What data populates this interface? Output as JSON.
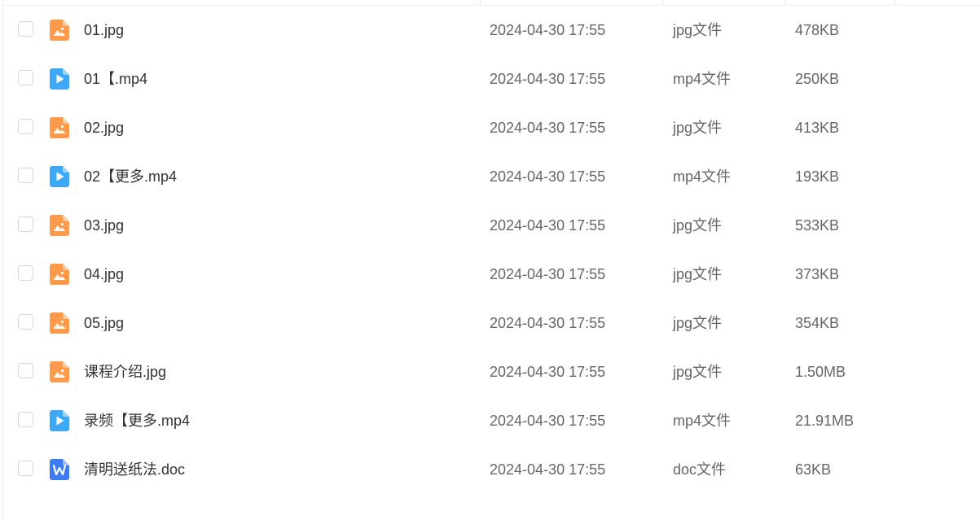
{
  "colors": {
    "image_icon": "#FF9A4D",
    "video_icon": "#3DA8F5",
    "doc_icon": "#3D7BF2",
    "name_text": "#333333",
    "meta_text": "#666666"
  },
  "files": [
    {
      "name": "01.jpg",
      "modified": "2024-04-30 17:55",
      "type": "jpg文件",
      "size": "478KB",
      "icon": "image-file-icon"
    },
    {
      "name": "01【.mp4",
      "modified": "2024-04-30 17:55",
      "type": "mp4文件",
      "size": "250KB",
      "icon": "video-file-icon"
    },
    {
      "name": "02.jpg",
      "modified": "2024-04-30 17:55",
      "type": "jpg文件",
      "size": "413KB",
      "icon": "image-file-icon"
    },
    {
      "name": "02【更多.mp4",
      "modified": "2024-04-30 17:55",
      "type": "mp4文件",
      "size": "193KB",
      "icon": "video-file-icon"
    },
    {
      "name": "03.jpg",
      "modified": "2024-04-30 17:55",
      "type": "jpg文件",
      "size": "533KB",
      "icon": "image-file-icon"
    },
    {
      "name": "04.jpg",
      "modified": "2024-04-30 17:55",
      "type": "jpg文件",
      "size": "373KB",
      "icon": "image-file-icon"
    },
    {
      "name": "05.jpg",
      "modified": "2024-04-30 17:55",
      "type": "jpg文件",
      "size": "354KB",
      "icon": "image-file-icon"
    },
    {
      "name": "课程介绍.jpg",
      "modified": "2024-04-30 17:55",
      "type": "jpg文件",
      "size": "1.50MB",
      "icon": "image-file-icon"
    },
    {
      "name": "录频【更多.mp4",
      "modified": "2024-04-30 17:55",
      "type": "mp4文件",
      "size": "21.91MB",
      "icon": "video-file-icon"
    },
    {
      "name": "清明送纸法.doc",
      "modified": "2024-04-30 17:55",
      "type": "doc文件",
      "size": "63KB",
      "icon": "word-doc-icon"
    }
  ]
}
